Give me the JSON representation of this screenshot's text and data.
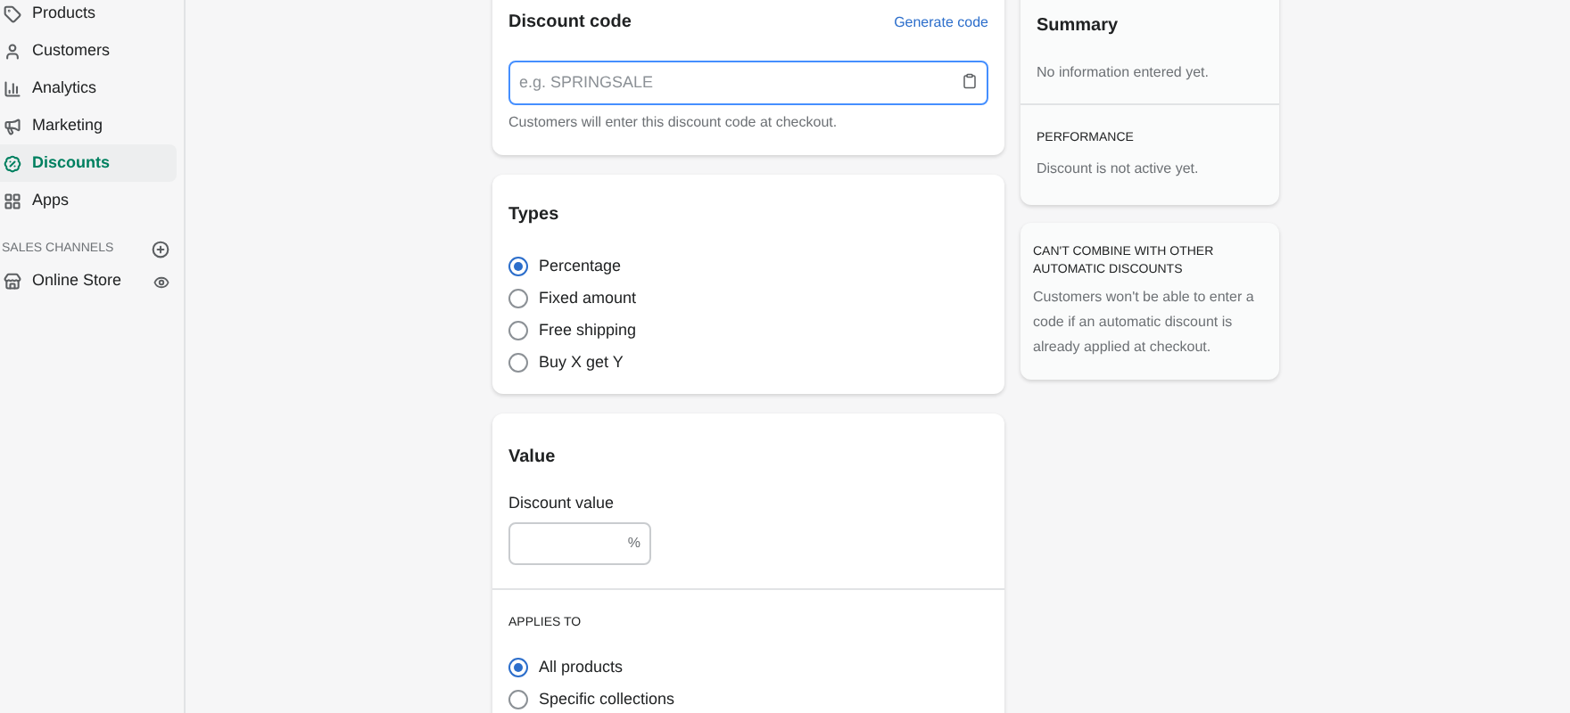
{
  "sidebar": {
    "items": [
      {
        "label": "Products",
        "selected": false
      },
      {
        "label": "Customers",
        "selected": false
      },
      {
        "label": "Analytics",
        "selected": false
      },
      {
        "label": "Marketing",
        "selected": false
      },
      {
        "label": "Discounts",
        "selected": true
      },
      {
        "label": "Apps",
        "selected": false
      }
    ],
    "section": {
      "title": "SALES CHANNELS",
      "channels": [
        {
          "label": "Online Store"
        }
      ]
    }
  },
  "discount_code": {
    "title": "Discount code",
    "link": "Generate code",
    "placeholder": "e.g. SPRINGSALE",
    "help": "Customers will enter this discount code at checkout."
  },
  "types": {
    "title": "Types",
    "options": [
      {
        "label": "Percentage",
        "selected": true
      },
      {
        "label": "Fixed amount",
        "selected": false
      },
      {
        "label": "Free shipping",
        "selected": false
      },
      {
        "label": "Buy X get Y",
        "selected": false
      }
    ]
  },
  "value": {
    "title": "Value",
    "field_label": "Discount value",
    "suffix": "%",
    "applies_to": {
      "title": "APPLIES TO",
      "options": [
        {
          "label": "All products",
          "selected": true
        },
        {
          "label": "Specific collections",
          "selected": false
        }
      ]
    }
  },
  "summary": {
    "title": "Summary",
    "text": "No information entered yet.",
    "performance_title": "PERFORMANCE",
    "performance_text": "Discount is not active yet."
  },
  "combine": {
    "title": "CAN'T COMBINE WITH OTHER AUTOMATIC DISCOUNTS",
    "text": "Customers won't be able to enter a code if an automatic discount is already applied at checkout."
  }
}
